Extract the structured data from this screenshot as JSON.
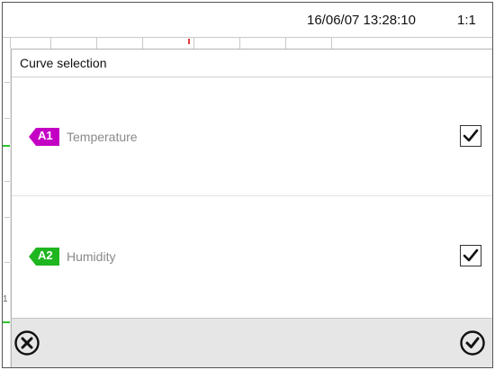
{
  "status_bar": {
    "datetime": "16/06/07 13:28:10",
    "zoom": "1:1"
  },
  "background_chart": {
    "axis_digit": "1"
  },
  "dialog": {
    "title": "Curve selection",
    "curves": [
      {
        "tag": "A1",
        "label": "Temperature",
        "checked": true,
        "tag_color": "#c400c4"
      },
      {
        "tag": "A2",
        "label": "Humidity",
        "checked": true,
        "tag_color": "#1fb61f"
      }
    ],
    "footer": {
      "cancel_icon": "circle-x-icon",
      "confirm_icon": "circle-check-icon"
    }
  }
}
